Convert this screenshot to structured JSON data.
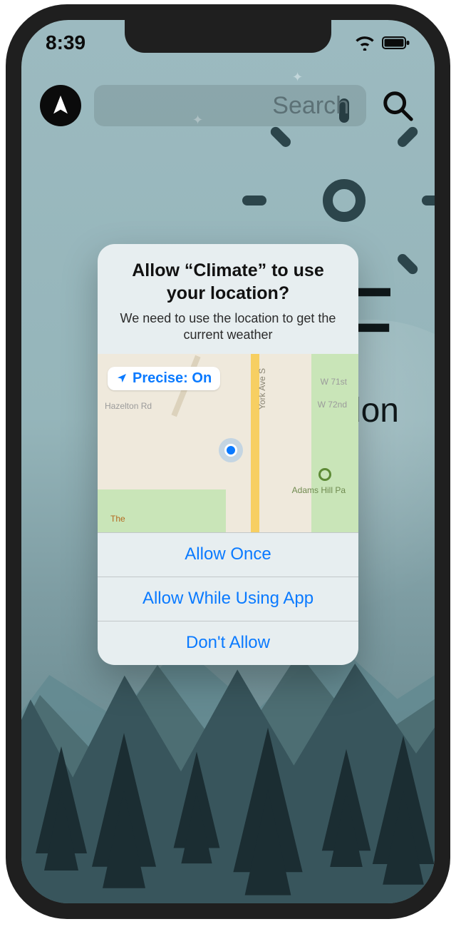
{
  "status": {
    "time": "8:39"
  },
  "header": {
    "search_placeholder": "Search"
  },
  "weather": {
    "temp_unit": "F",
    "city_fragment": "don"
  },
  "alert": {
    "title": "Allow “Climate” to use your location?",
    "subtitle": "We need to use the location to get the current weather",
    "precise_label": "Precise: On",
    "map_labels": {
      "hazelton": "Hazelton Rd",
      "w71": "W 71st",
      "w72": "W 72nd",
      "adams": "Adams Hill Pa",
      "the": "The",
      "york": "York Ave S"
    },
    "buttons": {
      "once": "Allow Once",
      "while": "Allow While Using App",
      "deny": "Don't Allow"
    }
  }
}
